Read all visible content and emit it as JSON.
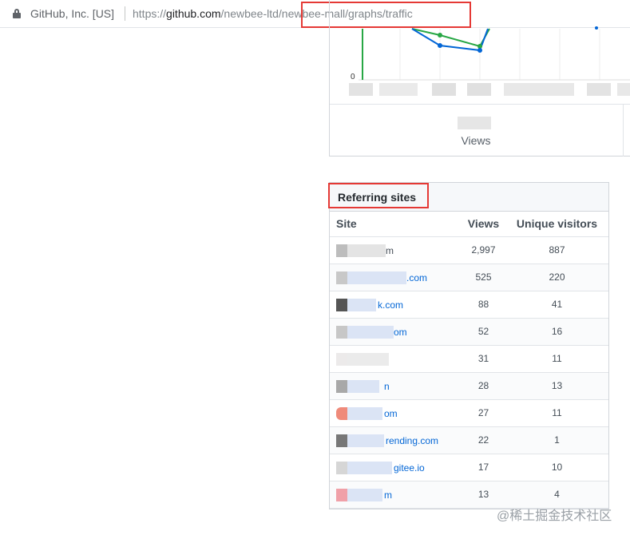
{
  "browser": {
    "site_identity": "GitHub, Inc. [US]",
    "url_prefix": "https://",
    "url_host": "github.com",
    "url_path_before": "/newbee-ltd",
    "url_path_highlight": "/newbee-mall/graphs/traffic"
  },
  "chart": {
    "zero_label": "0",
    "caption": "Views",
    "colors": {
      "views": "#28a745",
      "unique": "#0366d6"
    }
  },
  "referring": {
    "title": "Referring sites",
    "headers": {
      "site": "Site",
      "views": "Views",
      "unique": "Unique visitors"
    },
    "rows": [
      {
        "site": "m",
        "views": "2,997",
        "unique": "887"
      },
      {
        "site": ".com",
        "views": "525",
        "unique": "220"
      },
      {
        "site": "k.com",
        "views": "88",
        "unique": "41"
      },
      {
        "site": "om",
        "views": "52",
        "unique": "16"
      },
      {
        "site": "",
        "views": "31",
        "unique": "11"
      },
      {
        "site": "n",
        "views": "28",
        "unique": "13"
      },
      {
        "site": "om",
        "views": "27",
        "unique": "11"
      },
      {
        "site": "rending.com",
        "views": "22",
        "unique": "1"
      },
      {
        "site": "gitee.io",
        "views": "17",
        "unique": "10"
      },
      {
        "site": "m",
        "views": "13",
        "unique": "4"
      }
    ]
  },
  "watermark": "@稀土掘金技术社区"
}
